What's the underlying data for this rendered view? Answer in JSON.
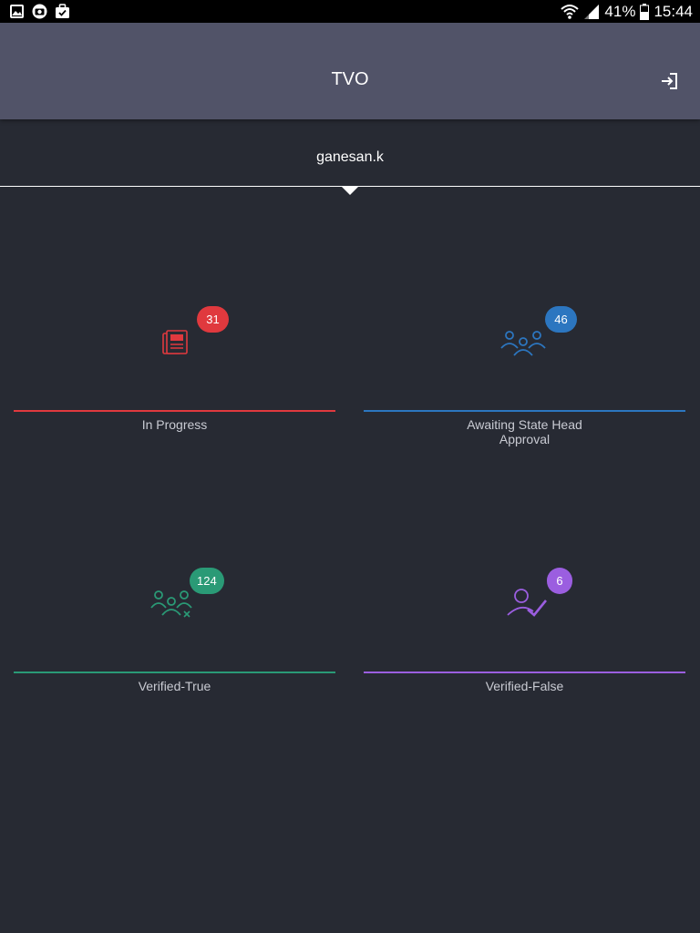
{
  "status_bar": {
    "battery": "41%",
    "time": "15:44",
    "icons": [
      "gallery-icon",
      "camera-icon",
      "briefcase-check-icon",
      "wifi-icon",
      "signal-icon",
      "battery-icon"
    ]
  },
  "app_bar": {
    "title": "TVO",
    "action_icon": "logout-icon"
  },
  "user": {
    "name": "ganesan.k"
  },
  "colors": {
    "background": "#272a33",
    "app_bar": "#515368",
    "in_progress": "#e0393e",
    "awaiting": "#2c76c0",
    "verified_true": "#2a9a76",
    "verified_false": "#9b5ee0"
  },
  "tiles": [
    {
      "label": "In Progress",
      "count": "31",
      "icon": "newspaper-icon",
      "color": "#e0393e"
    },
    {
      "label": "Awaiting State Head\nApproval",
      "count": "46",
      "icon": "group-icon",
      "color": "#2c76c0"
    },
    {
      "label": "Verified-True",
      "count": "124",
      "icon": "group-cross-icon",
      "color": "#2a9a76"
    },
    {
      "label": "Verified-False",
      "count": "6",
      "icon": "user-check-icon",
      "color": "#9b5ee0"
    }
  ]
}
